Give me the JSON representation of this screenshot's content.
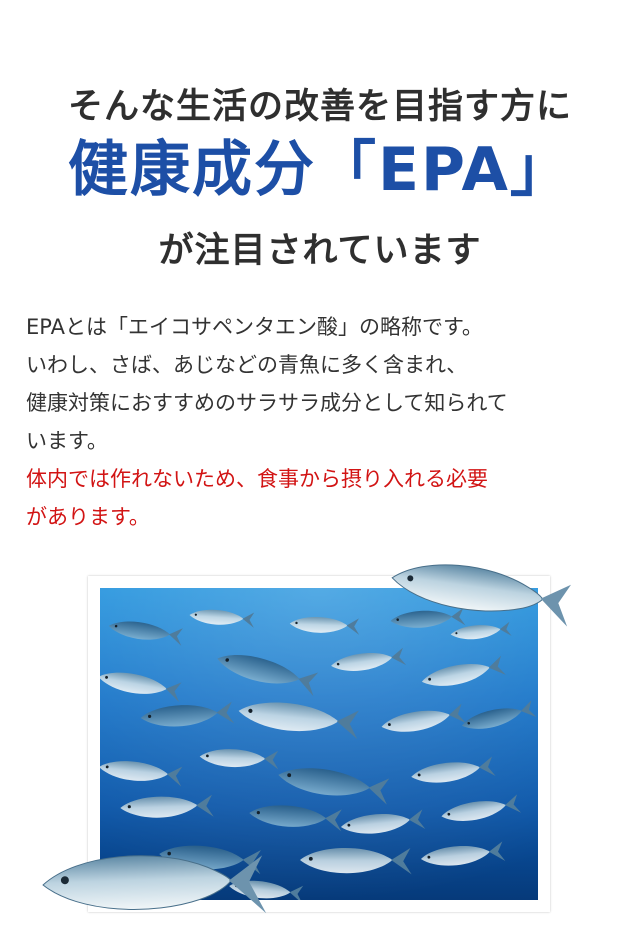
{
  "headline": {
    "line1": "そんな生活の改善を目指す方に",
    "line2": "健康成分「EPA」",
    "line3": "が注目されています"
  },
  "description": {
    "lines": [
      "EPAとは「エイコサペンタエン酸」の略称です。",
      "いわし、さば、あじなどの青魚に多く含まれ、",
      "健康対策におすすめのサラサラ成分として知られて",
      "います。"
    ],
    "highlight_lines": [
      "体内では作れないため、食事から摂り入れる必要",
      "があります。"
    ]
  },
  "colors": {
    "accent_blue": "#1d4fa6",
    "highlight_red": "#d21414",
    "text": "#333333"
  }
}
